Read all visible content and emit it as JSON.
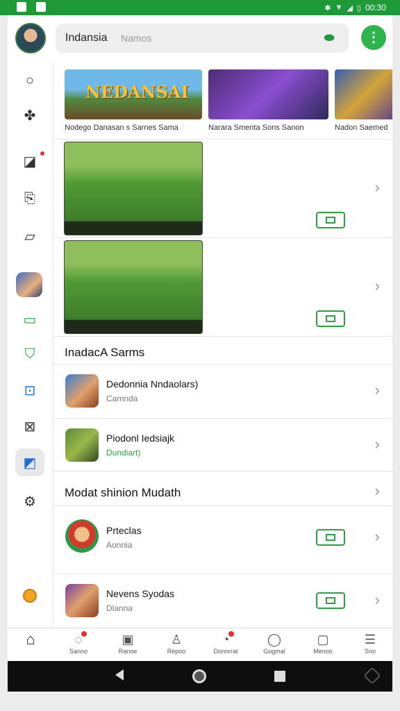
{
  "status_bar": {
    "time": "00:30"
  },
  "header": {
    "title": "Indansia",
    "placeholder": "Namos"
  },
  "carousel": [
    {
      "banner_text": "NEDANSAI",
      "caption": "Nodego Danasan s Sarnes Sama"
    },
    {
      "banner_text": "",
      "caption": "Narara Smenta Sons Sanon"
    },
    {
      "banner_text": "",
      "caption": "Nadon Saemed"
    }
  ],
  "section1": {
    "title": "InadacA Sarms"
  },
  "apps": [
    {
      "name": "Dedonnia Nndaolars)",
      "sub": "Camnda"
    },
    {
      "name": "Piodonl Iedsiajk",
      "sub": "Dundiart)"
    }
  ],
  "section2": {
    "title": "Modat shinion Mudath"
  },
  "apps2": [
    {
      "name": "Prteclas",
      "sub": "Aonnia"
    },
    {
      "name": "Nevens Syodas",
      "sub": "Dlanna"
    }
  ],
  "bottom_nav": [
    {
      "label": "",
      "icon": "home-icon"
    },
    {
      "label": "Sanno",
      "icon": "chat-icon"
    },
    {
      "label": "Ranoe",
      "icon": "store-icon"
    },
    {
      "label": "Repoo",
      "icon": "person-icon"
    },
    {
      "label": "Donnrrat",
      "icon": "alarm-icon"
    },
    {
      "label": "Gogmal",
      "icon": "bubble-icon"
    },
    {
      "label": "Menoo",
      "icon": "screen-icon"
    },
    {
      "label": "Sno",
      "icon": "list-icon"
    }
  ],
  "colors": {
    "accent": "#2aa243",
    "status_bar": "#1e9a38"
  }
}
